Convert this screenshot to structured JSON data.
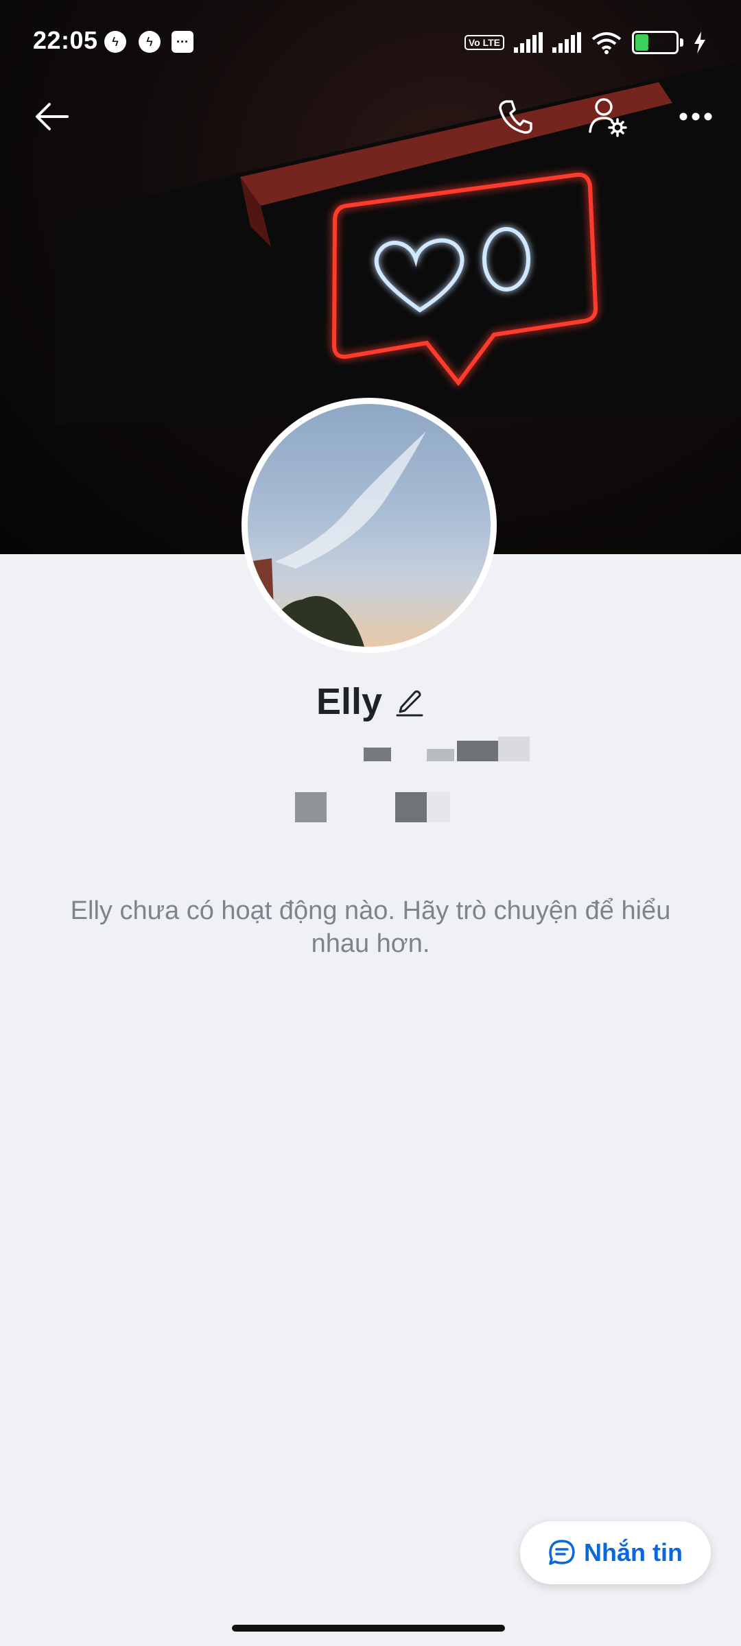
{
  "status_bar": {
    "time": "22:05",
    "battery": "28",
    "network_badge": "Vo LTE",
    "icons": [
      "messenger-icon",
      "messenger-icon",
      "sms-icon",
      "signal-icon",
      "signal-icon",
      "wifi-icon",
      "battery-icon",
      "charging-icon"
    ]
  },
  "toolbar": {
    "back_icon": "arrow-left-icon",
    "call_icon": "phone-icon",
    "settings_icon": "user-settings-icon",
    "more_icon": "more-dots-icon"
  },
  "profile": {
    "name": "Elly",
    "edit_icon": "pencil-icon"
  },
  "empty_state": {
    "message": "Elly chưa có hoạt động nào. Hãy trò chuyện để hiểu nhau hơn."
  },
  "actions": {
    "message_button_label": "Nhắn tin",
    "message_icon": "chat-bubble-icon"
  },
  "colors": {
    "accent": "#0a68d8",
    "background": "#eff1f5",
    "neon_red": "#ff3b2e",
    "neon_blue": "#cfe7ff"
  }
}
